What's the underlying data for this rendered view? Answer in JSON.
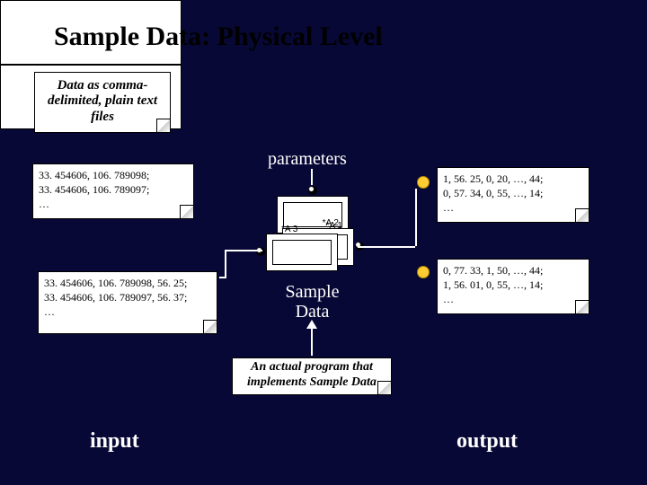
{
  "title": "Sample Data: Physical Level",
  "labels": {
    "parameters": "parameters",
    "sample_data": "Sample\nData",
    "input": "input",
    "output": "output"
  },
  "notes": {
    "note_title": "Data as comma-delimited, plain text files",
    "note_input_top": "33. 454606, 106. 789098;\n33. 454606, 106. 789097;\n…",
    "note_input_bottom": "33. 454606, 106. 789098, 56. 25;\n33. 454606, 106. 789097, 56. 37;\n…",
    "note_output_top": "1, 56. 25, 0, 20, …, 44;\n0, 57. 34, 0, 55, …, 14;\n…",
    "note_output_bottom": "0, 77. 33, 1, 50, …, 44;\n1, 56. 01, 0, 55, …, 14;\n…",
    "note_program": "An actual program that implements Sample Data"
  },
  "boxes": {
    "a1": "*A 1",
    "a2": "*A 2",
    "a3": "*A 3"
  }
}
